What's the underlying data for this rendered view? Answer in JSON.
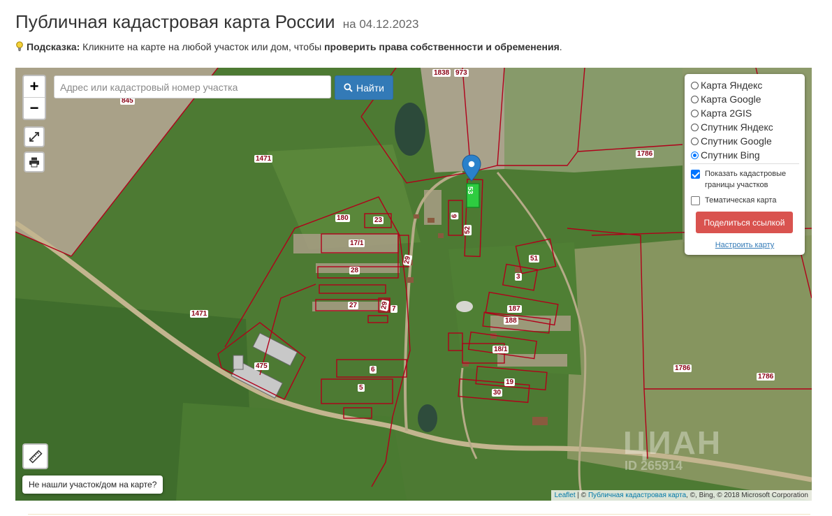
{
  "header": {
    "title": "Публичная кадастровая карта России",
    "date": "на 04.12.2023"
  },
  "hint": {
    "label": "Подсказка:",
    "text": " Кликните на карте на любой участок или дом, чтобы ",
    "bold": "проверить права собственности и обременения",
    "end": "."
  },
  "search": {
    "placeholder": "Адрес или кадастровый номер участка",
    "value": "",
    "button_label": "Найти"
  },
  "zoom": {
    "in_label": "+",
    "out_label": "−"
  },
  "layers": {
    "options": [
      {
        "label": "Карта Яндекс",
        "selected": false
      },
      {
        "label": "Карта Google",
        "selected": false
      },
      {
        "label": "Карта 2GIS",
        "selected": false
      },
      {
        "label": "Спутник Яндекс",
        "selected": false
      },
      {
        "label": "Спутник Google",
        "selected": false
      },
      {
        "label": "Спутник Bing",
        "selected": true
      }
    ],
    "show_borders_label": "Показать кадастровые границы участков",
    "show_borders_checked": true,
    "thematic_label": "Тематическая карта",
    "thematic_checked": false,
    "share_label": "Поделиться ссылкой",
    "configure_label": "Настроить карту"
  },
  "not_found_label": "Не нашли участок/дом на карте?",
  "attribution": {
    "leaflet": "Leaflet",
    "sep1": " | © ",
    "pkk": "Публичная кадастровая карта",
    "rest": ", ©, Bing, © 2018 Microsoft Corporation"
  },
  "watermark": {
    "brand": "ЦИАН",
    "id": "ID 265914"
  },
  "parcels": {
    "p1838": "1838",
    "p973": "973",
    "p845": "845",
    "p1471a": "1471",
    "p1471b": "1471",
    "p1786a": "1786",
    "p1786b": "1786",
    "p1786c": "1786",
    "p180": "180",
    "p23": "23",
    "p17_1": "17/1",
    "p28": "28",
    "p27": "27",
    "p29": "29",
    "p7": "7",
    "p6a": "6",
    "p475": "475",
    "p6": "6",
    "p5": "5",
    "p53": "53",
    "p29b": "29",
    "p52": "52",
    "p51": "51",
    "p3": "3",
    "p187": "187",
    "p188": "188",
    "p18_1": "18/1",
    "p19": "19",
    "p30": "30"
  },
  "colors": {
    "accent": "#337ab7",
    "share": "#d9534f",
    "selected_parcel": "#2ecc40",
    "boundary": "#c0001a",
    "marker": "#2a81cb"
  }
}
